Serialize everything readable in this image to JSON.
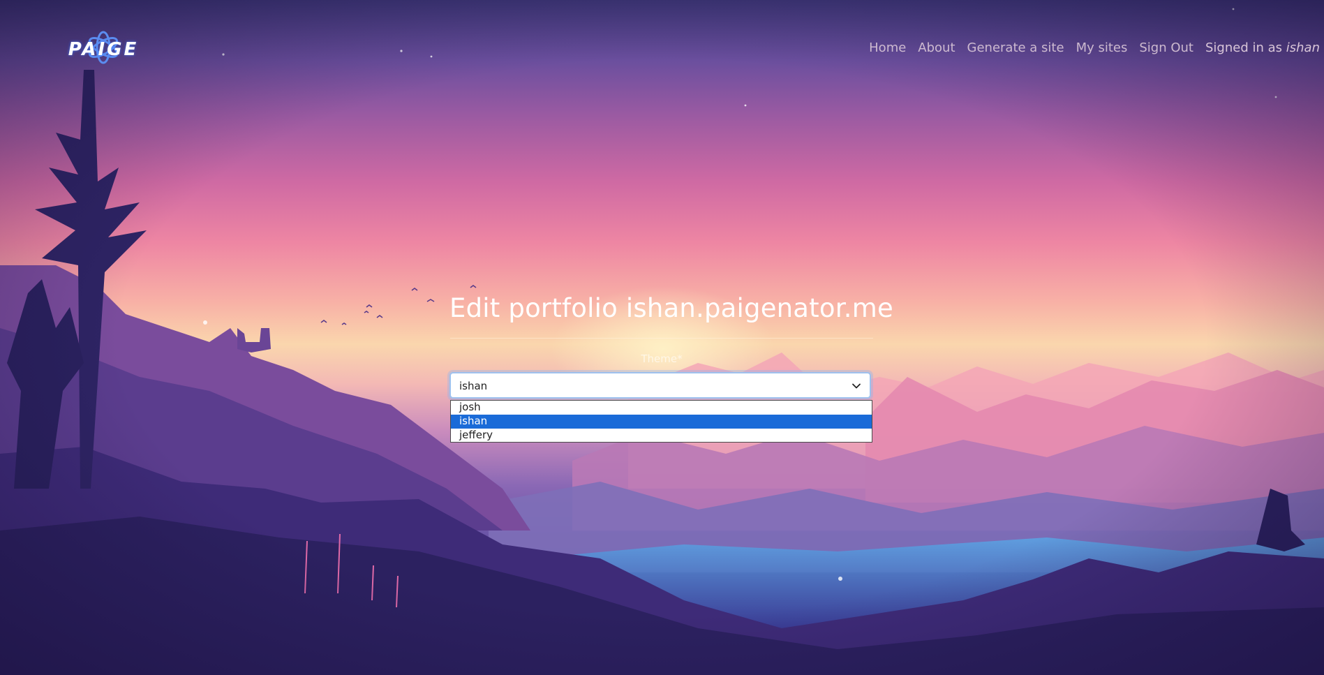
{
  "logo": {
    "text": "PAIGE"
  },
  "nav": {
    "items": [
      "Home",
      "About",
      "Generate a site",
      "My sites",
      "Sign Out"
    ],
    "signed_in_prefix": "Signed in as",
    "signed_in_user": "ishan"
  },
  "page": {
    "title": "Edit portfolio ishan.paigenator.me"
  },
  "theme_field": {
    "label": "Theme*",
    "selected": "ishan",
    "options": [
      {
        "label": "josh",
        "highlighted": false
      },
      {
        "label": "ishan",
        "highlighted": true
      },
      {
        "label": "jeffery",
        "highlighted": false
      }
    ]
  },
  "icons": [
    "logo-ring-icon",
    "chevron-down-icon"
  ],
  "colors": {
    "highlight": "#1a6bd8",
    "nav_text": "#d7c4d6"
  }
}
